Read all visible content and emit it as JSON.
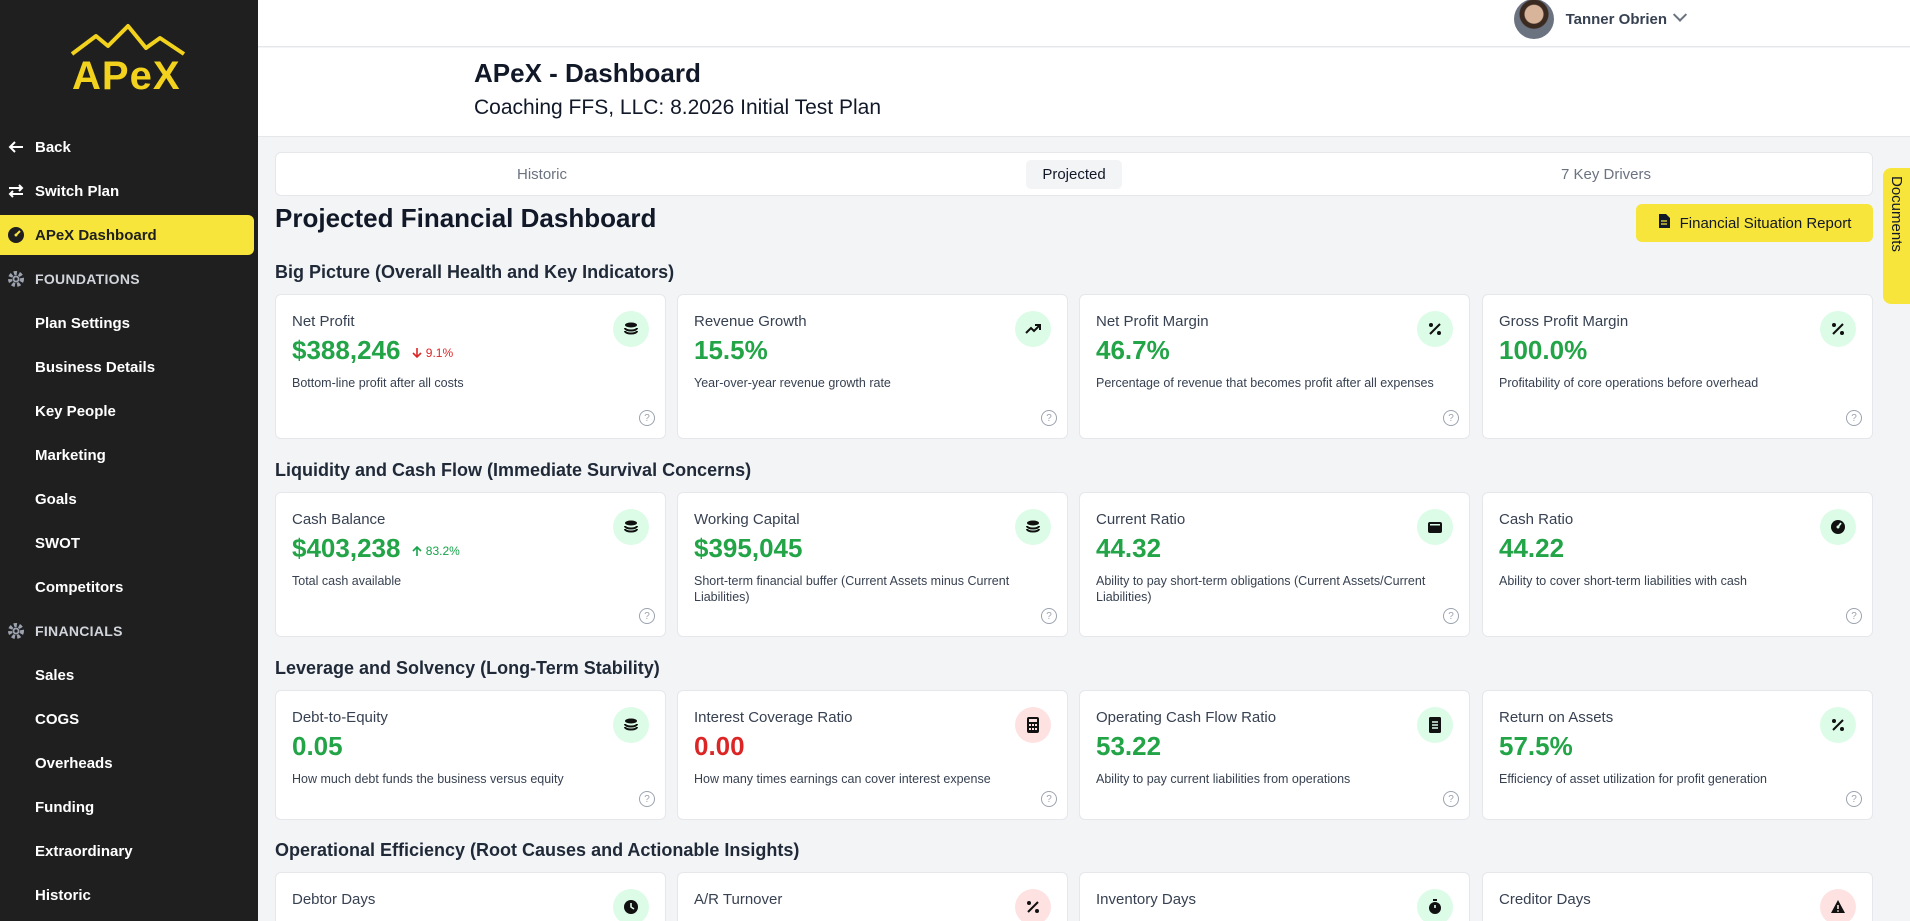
{
  "app": {
    "logo_text": "APeX"
  },
  "user": {
    "name": "Tanner Obrien"
  },
  "header": {
    "title": "APeX - Dashboard",
    "subtitle": "Coaching FFS, LLC: 8.2026 Initial Test Plan"
  },
  "sidebar": {
    "items": [
      {
        "label": "Back",
        "icon": "arrow-left-icon"
      },
      {
        "label": "Switch Plan",
        "icon": "swap-icon"
      },
      {
        "label": "APeX Dashboard",
        "icon": "dashboard-icon",
        "active": true
      },
      {
        "label": "FOUNDATIONS",
        "icon": "gear-icon",
        "section": true
      },
      {
        "label": "Plan Settings"
      },
      {
        "label": "Business Details"
      },
      {
        "label": "Key People"
      },
      {
        "label": "Marketing"
      },
      {
        "label": "Goals"
      },
      {
        "label": "SWOT"
      },
      {
        "label": "Competitors"
      },
      {
        "label": "FINANCIALS",
        "icon": "gear-icon",
        "section": true
      },
      {
        "label": "Sales"
      },
      {
        "label": "COGS"
      },
      {
        "label": "Overheads"
      },
      {
        "label": "Funding"
      },
      {
        "label": "Extraordinary"
      },
      {
        "label": "Historic"
      }
    ]
  },
  "tabs": [
    {
      "label": "Historic"
    },
    {
      "label": "Projected",
      "active": true
    },
    {
      "label": "7 Key Drivers"
    }
  ],
  "page": {
    "title": "Projected Financial Dashboard",
    "report_button": "Financial Situation Report",
    "docs_tab": "Documents"
  },
  "sections": [
    {
      "title": "Big Picture (Overall Health and Key Indicators)",
      "cards": [
        {
          "label": "Net Profit",
          "value": "$388,246",
          "delta": "9.1%",
          "delta_dir": "down",
          "desc": "Bottom-line profit after all costs",
          "icon": "coins-icon"
        },
        {
          "label": "Revenue Growth",
          "value": "15.5%",
          "desc": "Year-over-year revenue growth rate",
          "icon": "trending-up-icon"
        },
        {
          "label": "Net Profit Margin",
          "value": "46.7%",
          "desc": "Percentage of revenue that becomes profit after all expenses",
          "icon": "percent-icon"
        },
        {
          "label": "Gross Profit Margin",
          "value": "100.0%",
          "desc": "Profitability of core operations before overhead",
          "icon": "percent-icon"
        }
      ]
    },
    {
      "title": "Liquidity and Cash Flow (Immediate Survival Concerns)",
      "cards": [
        {
          "label": "Cash Balance",
          "value": "$403,238",
          "delta": "83.2%",
          "delta_dir": "up",
          "desc": "Total cash available",
          "icon": "coins-icon"
        },
        {
          "label": "Working Capital",
          "value": "$395,045",
          "desc": "Short-term financial buffer (Current Assets minus Current Liabilities)",
          "icon": "coins-icon"
        },
        {
          "label": "Current Ratio",
          "value": "44.32",
          "desc": "Ability to pay short-term obligations (Current Assets/Current Liabilities)",
          "icon": "wallet-icon"
        },
        {
          "label": "Cash Ratio",
          "value": "44.22",
          "desc": "Ability to cover short-term liabilities with cash",
          "icon": "gauge-icon"
        }
      ]
    },
    {
      "title": "Leverage and Solvency (Long-Term Stability)",
      "cards": [
        {
          "label": "Debt-to-Equity",
          "value": "0.05",
          "desc": "How much debt funds the business versus equity",
          "icon": "coins-icon"
        },
        {
          "label": "Interest Coverage Ratio",
          "value": "0.00",
          "value_color": "red",
          "desc": "How many times earnings can cover interest expense",
          "icon": "calculator-icon",
          "icon_bg": "red"
        },
        {
          "label": "Operating Cash Flow Ratio",
          "value": "53.22",
          "desc": "Ability to pay current liabilities from operations",
          "icon": "document-icon"
        },
        {
          "label": "Return on Assets",
          "value": "57.5%",
          "desc": "Efficiency of asset utilization for profit generation",
          "icon": "percent-icon"
        }
      ]
    },
    {
      "title": "Operational Efficiency (Root Causes and Actionable Insights)",
      "cards": [
        {
          "label": "Debtor Days",
          "icon": "clock-icon"
        },
        {
          "label": "A/R Turnover",
          "icon": "percent-icon",
          "icon_bg": "red"
        },
        {
          "label": "Inventory Days",
          "icon": "stopwatch-icon"
        },
        {
          "label": "Creditor Days",
          "icon": "warning-icon",
          "icon_bg": "red"
        }
      ]
    }
  ]
}
